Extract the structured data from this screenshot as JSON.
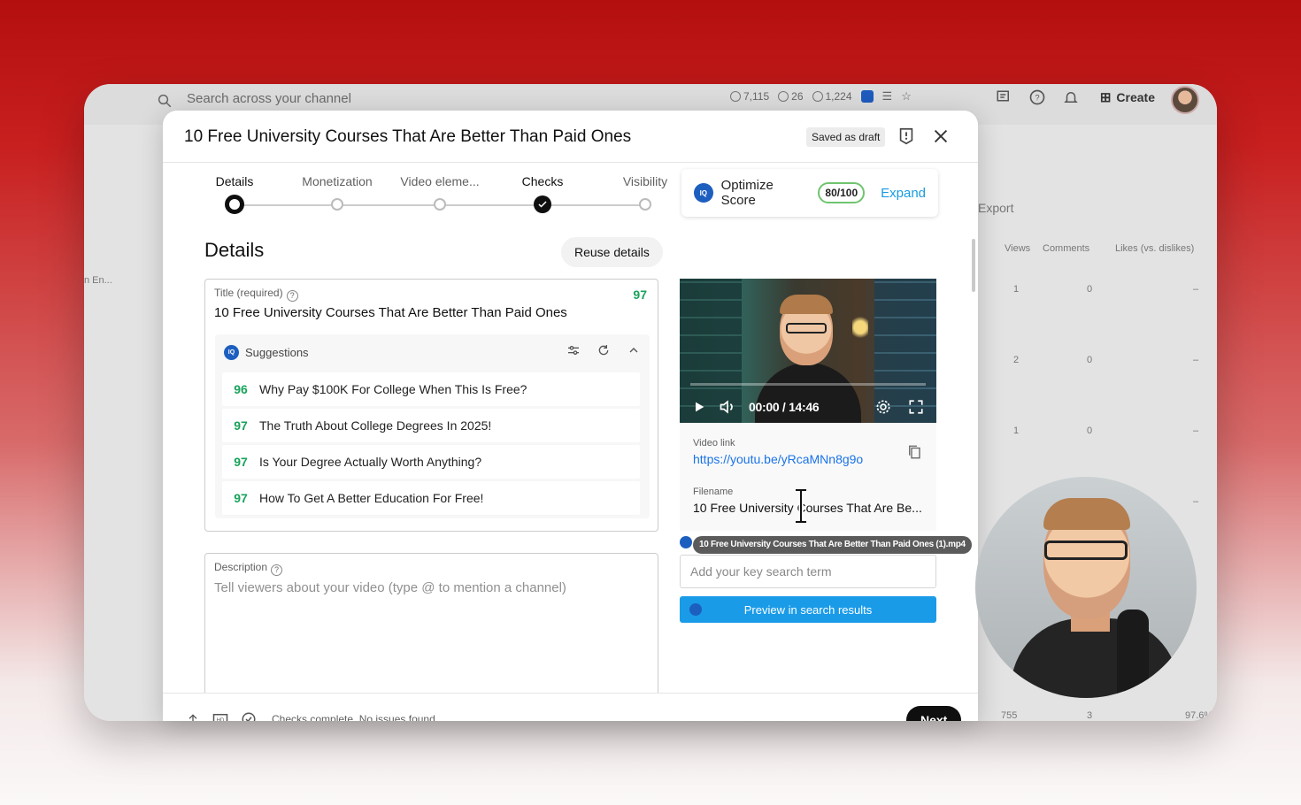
{
  "topbar": {
    "search_placeholder": "Search across your channel",
    "stats": [
      "7,115",
      "26",
      "1,224"
    ],
    "create_label": "Create"
  },
  "background": {
    "export_label": "Export",
    "left_label": "n En...",
    "columns": [
      "Views",
      "Comments",
      "Likes (vs. dislikes)"
    ],
    "rows": [
      {
        "views": "1",
        "comments": "0",
        "likes": "–"
      },
      {
        "views": "2",
        "comments": "0",
        "likes": "–"
      },
      {
        "views": "1",
        "comments": "0",
        "likes": "–"
      },
      {
        "views": "",
        "comments": "",
        "likes": "–"
      }
    ],
    "footer_row": {
      "views": "755",
      "comments": "3",
      "likes": "97.6%"
    }
  },
  "modal": {
    "title": "10 Free University Courses That Are Better Than Paid Ones",
    "draft_badge": "Saved as draft",
    "steps": [
      {
        "label": "Details",
        "state": "current"
      },
      {
        "label": "Monetization",
        "state": "empty"
      },
      {
        "label": "Video eleme...",
        "state": "empty"
      },
      {
        "label": "Checks",
        "state": "done"
      },
      {
        "label": "Visibility",
        "state": "empty"
      }
    ],
    "optimize": {
      "label": "Optimize Score",
      "score": "80/100",
      "expand": "Expand",
      "logo_text": "IQ"
    },
    "details_heading": "Details",
    "reuse_button": "Reuse details",
    "title_field": {
      "label": "Title (required)",
      "value": "10 Free University Courses That Are Better Than Paid Ones",
      "score": "97"
    },
    "suggestions": {
      "header": "Suggestions",
      "items": [
        {
          "score": "96",
          "text": "Why Pay $100K For College When This Is Free?"
        },
        {
          "score": "97",
          "text": "The Truth About College Degrees In 2025!"
        },
        {
          "score": "97",
          "text": "Is Your Degree Actually Worth Anything?"
        },
        {
          "score": "97",
          "text": "How To Get A Better Education For Free!"
        }
      ]
    },
    "description_field": {
      "label": "Description",
      "placeholder": "Tell viewers about your video (type @ to mention a channel)"
    },
    "video": {
      "time": "00:00 / 14:46",
      "link_label": "Video link",
      "link": "https://youtu.be/yRcaMNn8g9o",
      "filename_label": "Filename",
      "filename": "10 Free University Courses That Are Be...",
      "filename_tooltip": "10 Free University Courses That Are Better Than Paid Ones (1).mp4"
    },
    "search_term_placeholder": "Add your key search term",
    "preview_button": "Preview in search results",
    "footer": {
      "status": "Checks complete. No issues found.",
      "next_button": "Next"
    }
  },
  "colors": {
    "accent_green": "#18a35b",
    "link_blue": "#1a73e8",
    "preview_blue": "#1a9be8",
    "iq_blue": "#1d5fbf"
  }
}
